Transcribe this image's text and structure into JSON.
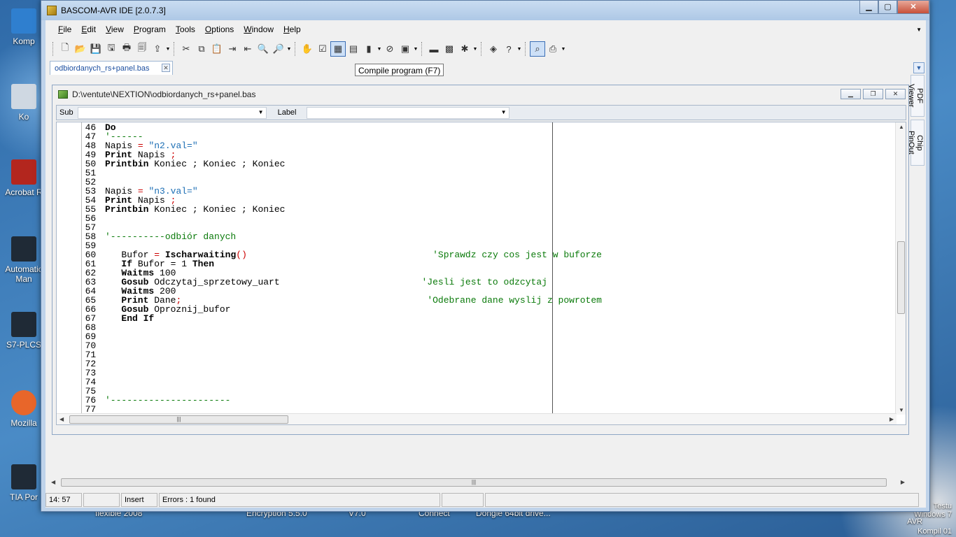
{
  "desktop": {
    "icons": [
      {
        "label": "Komp",
        "color": "#2f7fcf"
      },
      {
        "label": "Ko",
        "color": "#cfd8e2"
      },
      {
        "label": "Acrobat R",
        "color": "#b3261e"
      },
      {
        "label": "Automatic\nMan",
        "color": "#1f2a36"
      },
      {
        "label": "S7-PLCS",
        "color": "#1f2a36"
      },
      {
        "label": "Mozilla",
        "color": "#e8662a"
      },
      {
        "label": "TIA Por",
        "color": "#1f2a36"
      }
    ],
    "captions": [
      {
        "text": "flexible 2008"
      },
      {
        "text": "Encryption 5.5.0"
      },
      {
        "text": "V7.0"
      },
      {
        "text": "Connect"
      },
      {
        "text": "Dongle 64bit drive..."
      }
    ],
    "right_text": [
      "Testu",
      "Windows 7",
      "AVR",
      "Kompil",
      "01"
    ]
  },
  "window": {
    "title": "BASCOM-AVR IDE [2.0.7.3]",
    "controls": {
      "minimize": "▁",
      "maximize": "▢",
      "close": "✕"
    }
  },
  "menu": {
    "items": [
      {
        "label": "File",
        "underline": "F",
        "rest": "ile"
      },
      {
        "label": "Edit",
        "underline": "E",
        "rest": "dit"
      },
      {
        "label": "View",
        "underline": "V",
        "rest": "iew"
      },
      {
        "label": "Program",
        "underline": "P",
        "rest": "rogram"
      },
      {
        "label": "Tools",
        "underline": "T",
        "rest": "ools"
      },
      {
        "label": "Options",
        "underline": "O",
        "rest": "ptions"
      },
      {
        "label": "Window",
        "underline": "W",
        "rest": "indow"
      },
      {
        "label": "Help",
        "underline": "H",
        "rest": "elp"
      }
    ]
  },
  "toolbar": {
    "buttons": [
      {
        "icon": "new-file-icon",
        "glyph": "🗋"
      },
      {
        "icon": "open-folder-icon",
        "glyph": "📂"
      },
      {
        "icon": "save-icon",
        "glyph": "💾"
      },
      {
        "icon": "save-as-icon",
        "glyph": "🖫"
      },
      {
        "icon": "print-icon",
        "glyph": "🖶"
      },
      {
        "icon": "print-preview-icon",
        "glyph": "🗐"
      },
      {
        "icon": "export-icon",
        "glyph": "⇪"
      },
      {
        "icon": "cut-icon",
        "glyph": "✂"
      },
      {
        "icon": "copy-icon",
        "glyph": "⧉"
      },
      {
        "icon": "paste-icon",
        "glyph": "📋"
      },
      {
        "icon": "indent-icon",
        "glyph": "⇥"
      },
      {
        "icon": "unindent-icon",
        "glyph": "⇤"
      },
      {
        "icon": "find-icon",
        "glyph": "🔍"
      },
      {
        "icon": "find-next-icon",
        "glyph": "🔎"
      },
      {
        "icon": "hand-icon",
        "glyph": "✋"
      },
      {
        "icon": "syntax-check-icon",
        "glyph": "☑"
      },
      {
        "icon": "compile-icon",
        "glyph": "▦"
      },
      {
        "icon": "chip-icon",
        "glyph": "▤"
      },
      {
        "icon": "program-chip-icon",
        "glyph": "▮"
      },
      {
        "icon": "stop-icon",
        "glyph": "⊘"
      },
      {
        "icon": "simulator-icon",
        "glyph": "▣"
      },
      {
        "icon": "terminal-icon",
        "glyph": "▬"
      },
      {
        "icon": "lcd-icon",
        "glyph": "▩"
      },
      {
        "icon": "graphics-icon",
        "glyph": "✱"
      },
      {
        "icon": "info-icon",
        "glyph": "◈"
      },
      {
        "icon": "help-icon",
        "glyph": "?"
      },
      {
        "icon": "zoom-icon",
        "glyph": "⌕"
      },
      {
        "icon": "pdf-icon",
        "glyph": "⎙"
      }
    ]
  },
  "tabs": {
    "document": "odbiordanych_rs+panel.bas",
    "close": "✕"
  },
  "tooltip": "Compile program (F7)",
  "side_tabs": [
    "PDF Viewer",
    "Chip PinOut"
  ],
  "child": {
    "path": "D:\\ventute\\NEXTION\\odbiordanych_rs+panel.bas",
    "sub_label": "Sub",
    "label_label": "Label"
  },
  "code": [
    [
      {
        "t": "46 ",
        "c": "ln"
      },
      {
        "t": "Do",
        "c": "kw"
      }
    ],
    [
      {
        "t": "47 ",
        "c": "ln"
      },
      {
        "t": "'------",
        "c": "cmt"
      }
    ],
    [
      {
        "t": "48 ",
        "c": "ln"
      },
      {
        "t": "Napis ",
        "c": ""
      },
      {
        "t": "=",
        "c": "op"
      },
      {
        "t": " ",
        "c": ""
      },
      {
        "t": "\"n2.val=\"",
        "c": "str"
      }
    ],
    [
      {
        "t": "49 ",
        "c": "ln"
      },
      {
        "t": "Print",
        "c": "kw"
      },
      {
        "t": " Napis ",
        "c": ""
      },
      {
        "t": ";",
        "c": "op"
      }
    ],
    [
      {
        "t": "50 ",
        "c": "ln"
      },
      {
        "t": "Printbin",
        "c": "kw"
      },
      {
        "t": " Koniec ; Koniec ; Koniec",
        "c": ""
      }
    ],
    [
      {
        "t": "51 ",
        "c": "ln"
      }
    ],
    [
      {
        "t": "52 ",
        "c": "ln"
      }
    ],
    [
      {
        "t": "53 ",
        "c": "ln"
      },
      {
        "t": "Napis ",
        "c": ""
      },
      {
        "t": "=",
        "c": "op"
      },
      {
        "t": " ",
        "c": ""
      },
      {
        "t": "\"n3.val=\"",
        "c": "str"
      }
    ],
    [
      {
        "t": "54 ",
        "c": "ln"
      },
      {
        "t": "Print",
        "c": "kw"
      },
      {
        "t": " Napis ",
        "c": ""
      },
      {
        "t": ";",
        "c": "op"
      }
    ],
    [
      {
        "t": "55 ",
        "c": "ln"
      },
      {
        "t": "Printbin",
        "c": "kw"
      },
      {
        "t": " Koniec ; Koniec ; Koniec",
        "c": ""
      }
    ],
    [
      {
        "t": "56 ",
        "c": "ln"
      }
    ],
    [
      {
        "t": "57 ",
        "c": "ln"
      }
    ],
    [
      {
        "t": "58 ",
        "c": "ln"
      },
      {
        "t": "'----------odbiór danych",
        "c": "cmt"
      }
    ],
    [
      {
        "t": "59 ",
        "c": "ln"
      }
    ],
    [
      {
        "t": "60 ",
        "c": "ln"
      },
      {
        "t": "   Bufor ",
        "c": ""
      },
      {
        "t": "=",
        "c": "op"
      },
      {
        "t": " ",
        "c": ""
      },
      {
        "t": "Ischarwaiting",
        "c": "kw"
      },
      {
        "t": "()",
        "c": "op"
      },
      {
        "t": "                                  ",
        "c": ""
      },
      {
        "t": "'Sprawdz czy cos jest w buforze",
        "c": "cmt"
      }
    ],
    [
      {
        "t": "61 ",
        "c": "ln"
      },
      {
        "t": "   ",
        "c": ""
      },
      {
        "t": "If",
        "c": "kw"
      },
      {
        "t": " Bufor = 1 ",
        "c": ""
      },
      {
        "t": "Then",
        "c": "kw"
      }
    ],
    [
      {
        "t": "62 ",
        "c": "ln"
      },
      {
        "t": "   ",
        "c": ""
      },
      {
        "t": "Waitms",
        "c": "kw"
      },
      {
        "t": " 100",
        "c": ""
      }
    ],
    [
      {
        "t": "63 ",
        "c": "ln"
      },
      {
        "t": "   ",
        "c": ""
      },
      {
        "t": "Gosub",
        "c": "kw"
      },
      {
        "t": " Odczytaj_sprzetowy_uart                          ",
        "c": ""
      },
      {
        "t": "'Jesli jest to odzcytaj",
        "c": "cmt"
      }
    ],
    [
      {
        "t": "64 ",
        "c": "ln"
      },
      {
        "t": "   ",
        "c": ""
      },
      {
        "t": "Waitms",
        "c": "kw"
      },
      {
        "t": " 200",
        "c": ""
      }
    ],
    [
      {
        "t": "65 ",
        "c": "ln"
      },
      {
        "t": "   ",
        "c": ""
      },
      {
        "t": "Print",
        "c": "kw"
      },
      {
        "t": " Dane",
        "c": ""
      },
      {
        "t": ";",
        "c": "op"
      },
      {
        "t": "                                             ",
        "c": ""
      },
      {
        "t": "'Odebrane dane wyslij z powrotem",
        "c": "cmt"
      }
    ],
    [
      {
        "t": "66 ",
        "c": "ln"
      },
      {
        "t": "   ",
        "c": ""
      },
      {
        "t": "Gosub",
        "c": "kw"
      },
      {
        "t": " Oproznij_bufor",
        "c": ""
      }
    ],
    [
      {
        "t": "67 ",
        "c": "ln"
      },
      {
        "t": "   ",
        "c": ""
      },
      {
        "t": "End If",
        "c": "kw"
      }
    ],
    [
      {
        "t": "68 ",
        "c": "ln"
      }
    ],
    [
      {
        "t": "69 ",
        "c": "ln"
      }
    ],
    [
      {
        "t": "70 ",
        "c": "ln"
      }
    ],
    [
      {
        "t": "71 ",
        "c": "ln"
      }
    ],
    [
      {
        "t": "72 ",
        "c": "ln"
      }
    ],
    [
      {
        "t": "73 ",
        "c": "ln"
      }
    ],
    [
      {
        "t": "74 ",
        "c": "ln"
      }
    ],
    [
      {
        "t": "75 ",
        "c": "ln"
      }
    ],
    [
      {
        "t": "76 ",
        "c": "ln"
      },
      {
        "t": "'----------------------",
        "c": "cmt"
      }
    ],
    [
      {
        "t": "77 ",
        "c": "ln"
      }
    ]
  ],
  "status": {
    "position": "14: 57",
    "blank1": "",
    "mode": "Insert",
    "errors": "Errors : 1 found",
    "blank2": "",
    "blank3": ""
  },
  "colors": {
    "string": "#1d6fb5",
    "comment": "#0a7a0a",
    "operator": "#cc0000",
    "tab_text": "#1d4fa0"
  }
}
